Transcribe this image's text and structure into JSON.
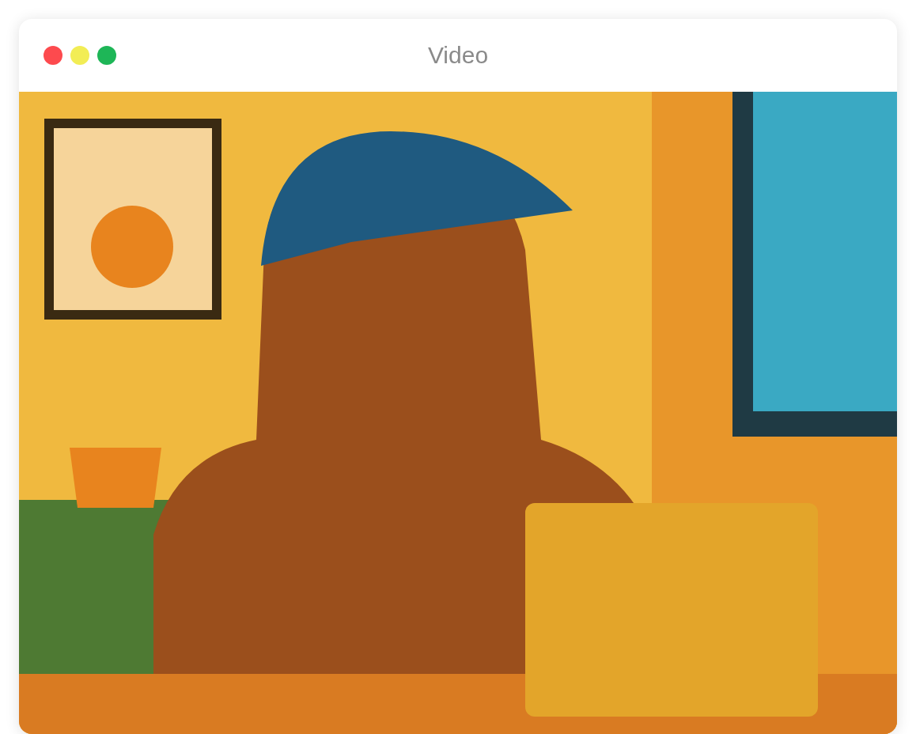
{
  "window": {
    "title": "Video"
  }
}
